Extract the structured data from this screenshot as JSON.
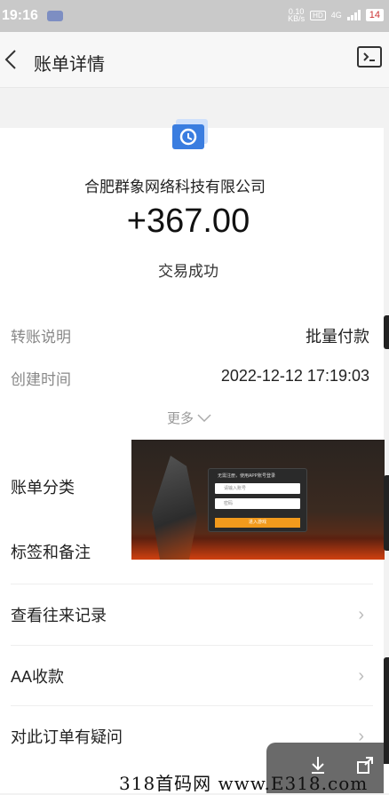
{
  "status_bar": {
    "time": "19:16",
    "speed": "0.10\nKB/s",
    "hd": "HD",
    "network": "4G",
    "battery": "14"
  },
  "nav": {
    "title": "账单详情"
  },
  "transaction": {
    "company": "合肥群象网络科技有限公司",
    "amount": "+367.00",
    "status": "交易成功"
  },
  "details": [
    {
      "label": "转账说明",
      "value": "批量付款"
    },
    {
      "label": "创建时间",
      "value": "2022-12-12 17:19:03"
    }
  ],
  "more_label": "更多",
  "list_items": [
    {
      "label": "账单分类"
    },
    {
      "label": "标签和备注"
    },
    {
      "label": "查看往来记录"
    },
    {
      "label": "AA收款"
    },
    {
      "label": "对此订单有疑问"
    }
  ],
  "ad": {
    "title": "无需注册，使用APP账号登录",
    "field1": "请输入账号",
    "field2": "密码",
    "button": "进入游戏"
  },
  "watermark": "318首码网 www.E318.com",
  "colors": {
    "accent": "#3a7de0",
    "ad_button": "#f29a1c"
  }
}
